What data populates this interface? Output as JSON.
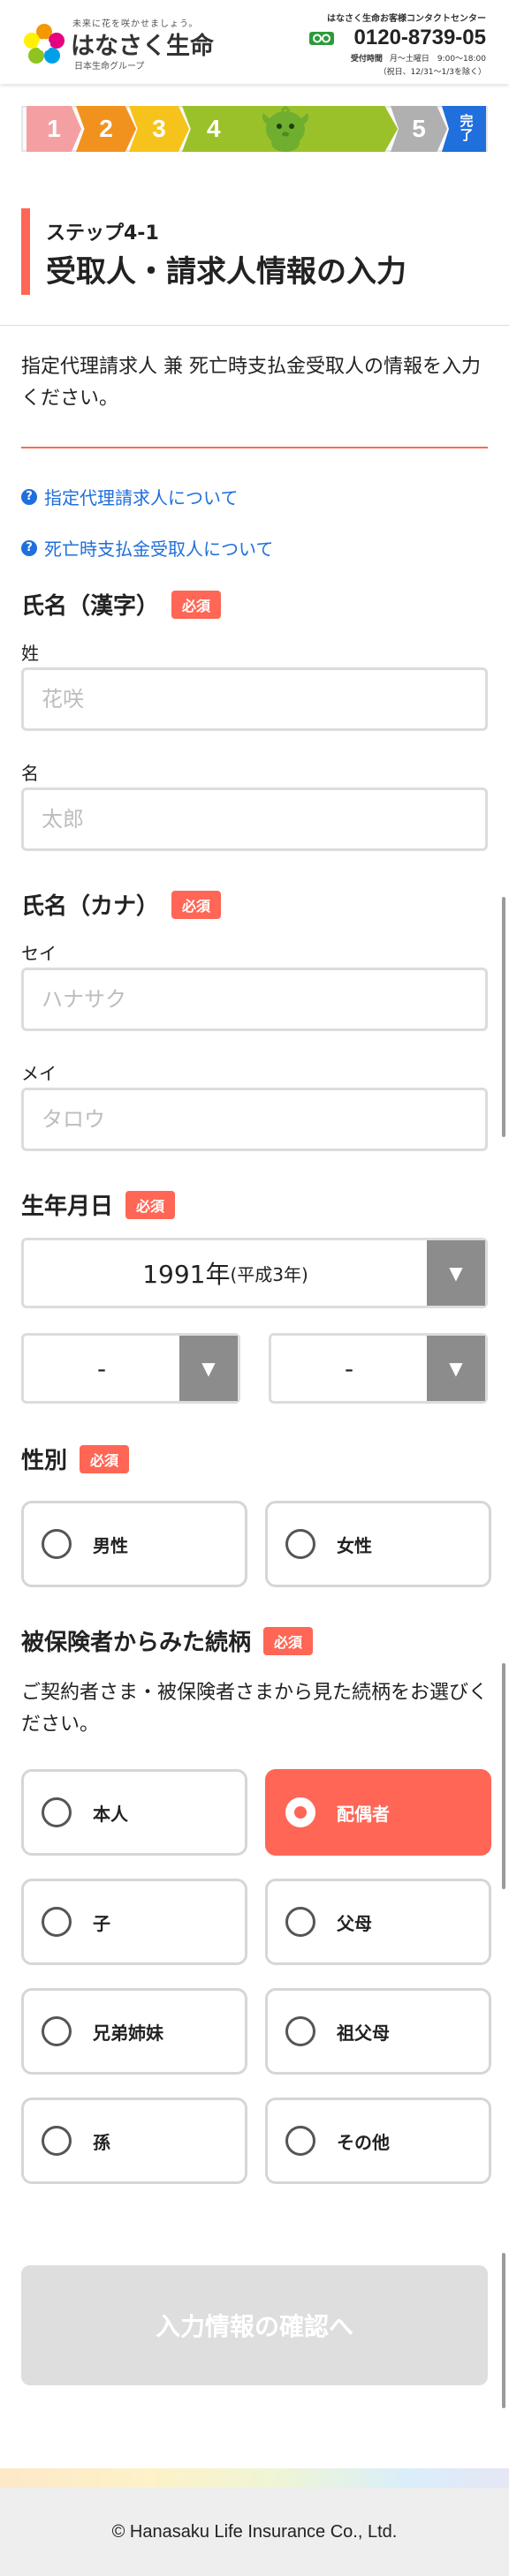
{
  "header": {
    "tagline": "未来に花を咲かせましょう。",
    "logo_name": "はなさく生命",
    "logo_group": "日本生命グループ",
    "contact_title": "はなさく生命お客様コンタクトセンター",
    "freedial_icon": "フリー",
    "tel": "0120-8739-05",
    "hours_label": "受付時間",
    "hours": "月～土曜日　9:00～18:00",
    "hours_note": "（祝日、12/31～1/3を除く）"
  },
  "progress": {
    "steps": [
      "1",
      "2",
      "3",
      "4",
      "5",
      "完了"
    ],
    "current_step": 4,
    "colors": [
      "#f4a0a3",
      "#f2921e",
      "#f5c31b",
      "#9bc12a",
      "#b0b0b0",
      "#1f6fdc"
    ]
  },
  "heading": {
    "sub": "ステップ4-1",
    "title": "受取人・請求人情報の入力"
  },
  "intro": "指定代理請求人 兼 死亡時支払金受取人の情報を入力ください。",
  "links": {
    "agent": "指定代理請求人について",
    "beneficiary": "死亡時支払金受取人について"
  },
  "required_label": "必須",
  "name_kanji": {
    "label": "氏名（漢字）",
    "last_label": "姓",
    "last_placeholder": "花咲",
    "first_label": "名",
    "first_placeholder": "太郎"
  },
  "name_kana": {
    "label": "氏名（カナ）",
    "last_label": "セイ",
    "last_placeholder": "ハナサク",
    "first_label": "メイ",
    "first_placeholder": "タロウ"
  },
  "birthdate": {
    "label": "生年月日",
    "year_value": "1991年",
    "year_era": "(平成3年)",
    "month_value": "-",
    "day_value": "-"
  },
  "gender": {
    "label": "性別",
    "options": [
      "男性",
      "女性"
    ],
    "selected": null
  },
  "relation": {
    "label": "被保険者からみた続柄",
    "note": "ご契約者さま・被保険者さまから見た続柄をお選びください。",
    "options": [
      "本人",
      "配偶者",
      "子",
      "父母",
      "兄弟姉妹",
      "祖父母",
      "孫",
      "その他"
    ],
    "selected": "配偶者"
  },
  "submit_label": "入力情報の確認へ",
  "footer": "© Hanasaku Life Insurance Co., Ltd.",
  "colors": {
    "accent": "#ff6655",
    "link": "#1f6fdc",
    "disabled": "#dedede"
  }
}
